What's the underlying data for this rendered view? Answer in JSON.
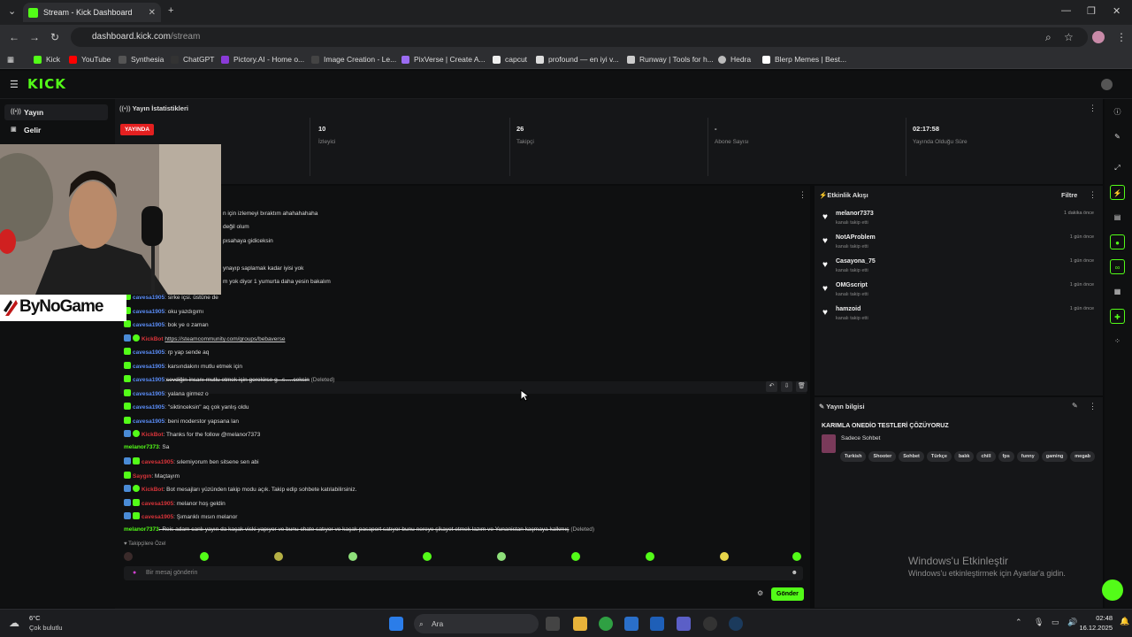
{
  "browser": {
    "tab_title": "Stream - Kick Dashboard",
    "url_domain": "dashboard.kick.com",
    "url_path": "/stream",
    "bookmarks": [
      "Kick",
      "YouTube",
      "Synthesia",
      "ChatGPT",
      "Pictory.AI - Home o...",
      "Image Creation - Le...",
      "PixVerse | Create A...",
      "capcut",
      "profound — en iyi v...",
      "Runway | Tools for h...",
      "Hedra",
      "Blerp Memes | Best..."
    ]
  },
  "app": {
    "logo": "KICK"
  },
  "sidebar": {
    "items": [
      {
        "label": "Yayın"
      },
      {
        "label": "Gelir"
      }
    ]
  },
  "stats": {
    "title": "Yayın İstatistikleri",
    "live_badge": "YAYINDA",
    "items": [
      {
        "value": "10",
        "label": "İzleyici"
      },
      {
        "value": "26",
        "label": "Takipçi"
      },
      {
        "value": "-",
        "label": "Abone Sayısı"
      },
      {
        "value": "02:17:58",
        "label": "Yayında Olduğu Süre"
      }
    ]
  },
  "chat": {
    "lines": [
      {
        "user": "",
        "text": "n için izlemeyi bıraktım ahahahahaha"
      },
      {
        "user": "",
        "text": "değil olum"
      },
      {
        "user": "",
        "text": "pısahaya gidiceksin"
      },
      {
        "user": "",
        "text": "ynayıp saplamak kadar iyisi yok"
      },
      {
        "user": "",
        "text": "m yok diyor 1 yumurta daha yesin bakalım"
      },
      {
        "user": "cavesa1905",
        "text": ": sirke içsi. üstüne de"
      },
      {
        "user": "cavesa1905",
        "text": ": oku yazdıgımı"
      },
      {
        "user": "cavesa1905",
        "text": ": bok ye o zaman"
      },
      {
        "user": "KickBot",
        "text": "https://steamcommunity.com/groups/bebaverse"
      },
      {
        "user": "cavesa1905",
        "text": ": rp yap sende aq"
      },
      {
        "user": "cavesa1905",
        "text": ": karsındakını mutlu etmek için"
      },
      {
        "user": "cavesa1905",
        "text": "sevdiğin insanı mutlu etmek için gerekirse g...s.....ceksin",
        "deleted": "(Deleted)"
      },
      {
        "user": "cavesa1905",
        "text": ": yalana girmez o"
      },
      {
        "user": "cavesa1905",
        "text": ": \"siktinceksin\" aq çok yanlış oldu"
      },
      {
        "user": "cavesa1905",
        "text": ": beni moderstor yapsana lan"
      },
      {
        "user": "KickBot",
        "text": ": Thanks for the follow @melanor7373"
      },
      {
        "user": "melanor7373",
        "text": ": Sa"
      },
      {
        "user": "cavesa1905",
        "text": ": sılemiyorum ben sitsene sen abi"
      },
      {
        "user": "Saygın",
        "text": ": Maçtayım"
      },
      {
        "user": "KickBot",
        "text": ": Bot mesajları yüzünden takip modu açık. Takip edip sohbete katılabilirsiniz."
      },
      {
        "user": "cavesa1905",
        "text": ": melanor hoş geldin"
      },
      {
        "user": "cavesa1905",
        "text": ": Şımarıklı mısın melanor"
      },
      {
        "user": "melanor7373",
        "text": ": Reis adam canlı yayın da kaçak viski yapıyor ve bunu chate satıyor ve kaçak pasaport satıyor bunu nereye şikayet etmek lazım ve Yunanistan kaçmaya kalkmış",
        "deleted": "(Deleted)"
      }
    ],
    "followers_only": "Takipçilere Özel",
    "input_placeholder": "Bir mesaj gönderin",
    "send_label": "Gönder"
  },
  "activity": {
    "title": "Etkinlik Akışı",
    "filter": "Filtre",
    "items": [
      {
        "name": "melanor7373",
        "sub": "kanalı takip etti",
        "time": "1 dakika önce"
      },
      {
        "name": "NotAProblem",
        "sub": "kanalı takip etti",
        "time": "1 gün önce"
      },
      {
        "name": "Casayona_75",
        "sub": "kanalı takip etti",
        "time": "1 gün önce"
      },
      {
        "name": "OMGscript",
        "sub": "kanalı takip etti",
        "time": "1 gün önce"
      },
      {
        "name": "hamzoid",
        "sub": "kanalı takip etti",
        "time": "1 gün önce"
      }
    ]
  },
  "stream_info": {
    "title": "Yayın bilgisi",
    "stream_title": "KARIMLA ONEDİO TESTLERİ ÇÖZÜYORUZ",
    "category": "Sadece Sohbet",
    "tags": [
      "Turkish",
      "Shooter",
      "Sohbet",
      "Türkçe",
      "balık",
      "chill",
      "fps",
      "funny",
      "gaming",
      "megab"
    ]
  },
  "overlay": {
    "brand": "ByNoGame"
  },
  "watermark": {
    "line1": "Windows'u Etkinleştir",
    "line2": "Windows'u etkinleştirmek için Ayarlar'a gidin."
  },
  "taskbar": {
    "weather_temp": "6°C",
    "weather_desc": "Çok bulutlu",
    "search": "Ara",
    "time": "02:48",
    "date": "16.12.2025"
  },
  "colors": {
    "accent": "#53fc18",
    "live": "#e42020",
    "user_blue": "#5a8cf5",
    "user_red": "#d9343a"
  }
}
